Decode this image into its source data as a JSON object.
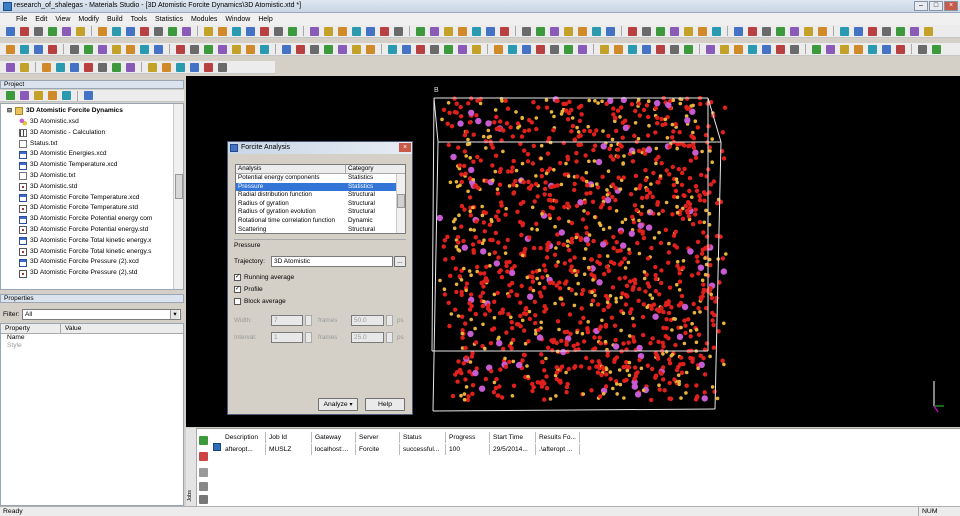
{
  "window": {
    "title": "research_of_shalegas - Materials Studio - [3D Atomistic Forcite Dynamics\\3D Atomistic.xtd *]"
  },
  "menu": [
    "File",
    "Edit",
    "View",
    "Modify",
    "Build",
    "Tools",
    "Statistics",
    "Modules",
    "Window",
    "Help"
  ],
  "project": {
    "header": "Project",
    "root": "3D Atomistic Forcite Dynamics",
    "items": [
      {
        "label": "3D Atomistic.xsd",
        "icon": "xsd"
      },
      {
        "label": "3D Atomistic - Calculation",
        "icon": "calc"
      },
      {
        "label": "Status.txt",
        "icon": "txt"
      },
      {
        "label": "3D Atomistic Energies.xcd",
        "icon": "xcd"
      },
      {
        "label": "3D Atomistic Temperature.xcd",
        "icon": "xcd"
      },
      {
        "label": "3D Atomistic.txt",
        "icon": "txt"
      },
      {
        "label": "3D Atomistic.std",
        "icon": "std"
      },
      {
        "label": "3D Atomistic Forcite Temperature.xcd",
        "icon": "xcd"
      },
      {
        "label": "3D Atomistic Forcite Temperature.std",
        "icon": "std"
      },
      {
        "label": "3D Atomistic Forcite Potential energy com",
        "icon": "xcd"
      },
      {
        "label": "3D Atomistic Forcite Potential energy.std",
        "icon": "std"
      },
      {
        "label": "3D Atomistic Forcite Total kinetic energy.x",
        "icon": "xcd"
      },
      {
        "label": "3D Atomistic Forcite Total kinetic energy.s",
        "icon": "std"
      },
      {
        "label": "3D Atomistic Forcite Pressure (2).xcd",
        "icon": "xcd"
      },
      {
        "label": "3D Atomistic Forcite Pressure (2).std",
        "icon": "std"
      }
    ]
  },
  "properties": {
    "header": "Properties",
    "filter_label": "Filter:",
    "filter_value": "All",
    "col_property": "Property",
    "col_value": "Value",
    "rows": [
      "Name",
      "Style"
    ]
  },
  "dialog": {
    "title": "Forcite Analysis",
    "col_analysis": "Analysis",
    "col_category": "Category",
    "rows": [
      {
        "analysis": "Potential energy components",
        "category": "Statistics"
      },
      {
        "analysis": "Pressure",
        "category": "Statistics",
        "selected": true
      },
      {
        "analysis": "Radial distribution function",
        "category": "Structural"
      },
      {
        "analysis": "Radius of gyration",
        "category": "Structural"
      },
      {
        "analysis": "Radius of gyration evolution",
        "category": "Structural"
      },
      {
        "analysis": "Rotational time correlation function",
        "category": "Dynamic"
      },
      {
        "analysis": "Scattering",
        "category": "Structural"
      }
    ],
    "section": "Pressure",
    "trajectory_label": "Trajectory:",
    "trajectory_value": "3D Atomistic",
    "browse": "...",
    "running_average": "Running average",
    "profile": "Profile",
    "block_average": "Block average",
    "width_label": "Width:",
    "width_value": "7",
    "frames": "frames",
    "width_ps": "50.0",
    "interval_label": "Interval:",
    "interval_value": "1",
    "interval_ps": "25.0",
    "ps": "ps",
    "analyze": "Analyze",
    "help": "Help"
  },
  "viewport": {
    "axis_label": "B"
  },
  "jobs": {
    "side_label": "Jobs",
    "columns": [
      "Description",
      "Job Id",
      "Gateway",
      "Server",
      "Status",
      "Progress",
      "Start Time",
      "Results Fo..."
    ],
    "row": [
      "afteropt...",
      "MUSLZ",
      "localhost:...",
      "Forcite",
      "successful...",
      "100",
      "29/5/2014...",
      ".\\afteropt ..."
    ]
  },
  "status": {
    "left": "Ready",
    "num": "NUM"
  },
  "colors": {
    "oxygen": "#e0201c",
    "silicon": "#e8b33a",
    "other": "#c75bd2",
    "cell": "#e8e8e8",
    "selection": "#3375d7"
  }
}
